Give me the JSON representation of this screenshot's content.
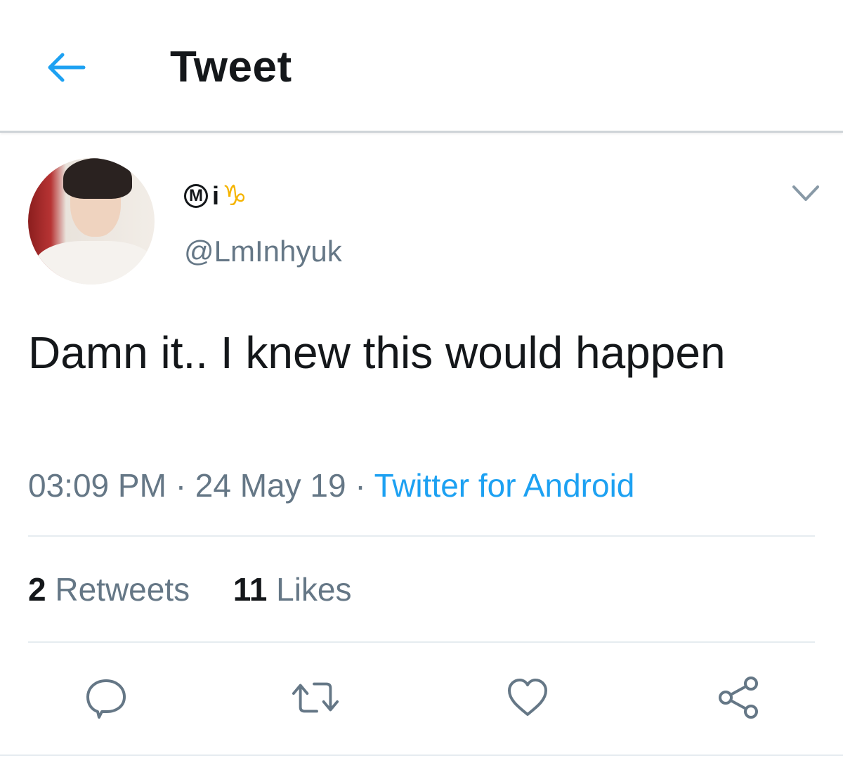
{
  "header": {
    "back_icon": "arrow-left-icon",
    "title": "Tweet",
    "accent_color": "#1da1f2"
  },
  "tweet": {
    "author": {
      "display_name_parts": [
        "M",
        "i",
        "♑"
      ],
      "handle": "@LmInhyuk"
    },
    "menu_icon": "chevron-down-icon",
    "text": "Damn it.. I knew this would happen",
    "time": "03:09 PM",
    "separator": "·",
    "date": "24 May 19",
    "source": "Twitter for Android"
  },
  "stats": {
    "retweets_count": "2",
    "retweets_label": "Retweets",
    "likes_count": "11",
    "likes_label": "Likes"
  },
  "actions": [
    "reply-icon",
    "retweet-icon",
    "like-icon",
    "share-icon"
  ]
}
